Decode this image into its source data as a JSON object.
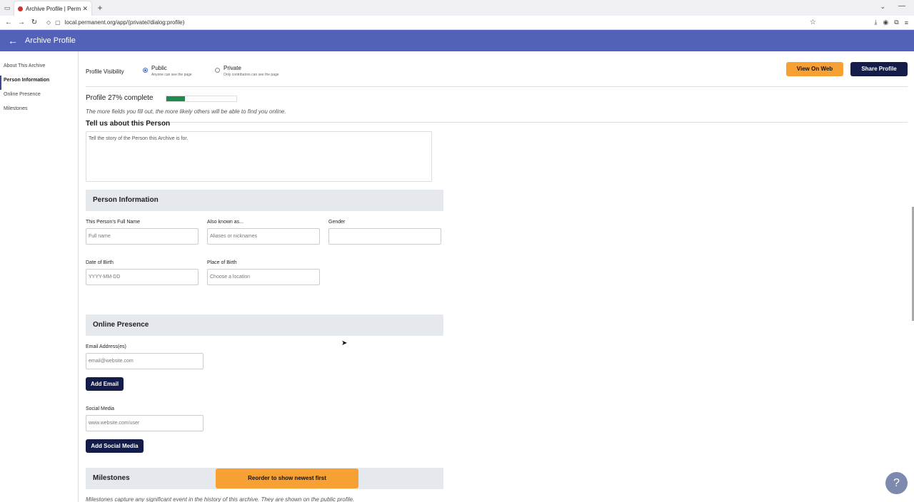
{
  "browser": {
    "tab_title": "Archive Profile | Permanent",
    "url": "local.permanent.org/app/(private//dialog:profile)"
  },
  "app": {
    "title": "Archive Profile"
  },
  "sidebar": {
    "items": [
      {
        "label": "About This Archive"
      },
      {
        "label": "Person Information"
      },
      {
        "label": "Online Presence"
      },
      {
        "label": "Milestones"
      }
    ]
  },
  "visibility": {
    "label": "Profile Visibility",
    "public_label": "Public",
    "public_sub": "Anyone can see the page",
    "private_label": "Private",
    "private_sub": "Only contributors can see the page",
    "selected": "Public",
    "view_web_label": "View On Web",
    "share_label": "Share Profile"
  },
  "progress": {
    "title": "Profile 27% complete",
    "percent": 27,
    "note": "The more fields you fill out, the more likely others will be able to find you online."
  },
  "story": {
    "title": "Tell us about this Person",
    "placeholder": "Tell the story of the Person this Archive is for."
  },
  "person": {
    "heading": "Person Information",
    "full_name_label": "This Person's Full Name",
    "full_name_placeholder": "Full name",
    "aka_label": "Also known as...",
    "aka_placeholder": "Aliases or nicknames",
    "gender_label": "Gender",
    "gender_placeholder": "",
    "dob_label": "Date of Birth",
    "dob_placeholder": "YYYY-MM-DD",
    "pob_label": "Place of Birth",
    "pob_placeholder": "Choose a location"
  },
  "online": {
    "heading": "Online Presence",
    "email_label": "Email Address(es)",
    "email_placeholder": "email@website.com",
    "add_email_label": "Add Email",
    "social_label": "Social Media",
    "social_placeholder": "www.website.com/user",
    "add_social_label": "Add Social Media"
  },
  "milestones": {
    "heading": "Milestones",
    "reorder_label": "Reorder to show newest first",
    "note": "Milestones capture any significant event in the history of this archive. They are shown on the public profile."
  },
  "help": {
    "label": "?"
  },
  "colors": {
    "header": "#5162b8",
    "orange": "#f7a034",
    "navy": "#141d4a",
    "progress": "#1e8a4c"
  }
}
